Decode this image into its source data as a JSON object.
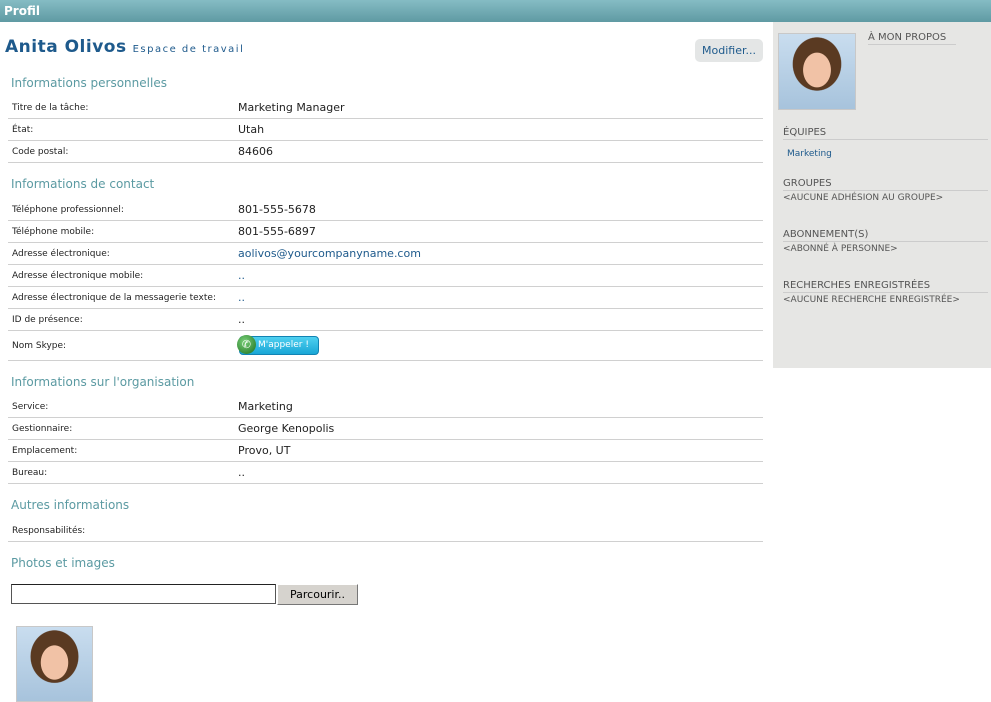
{
  "header": {
    "title": "Profil"
  },
  "profile": {
    "name": "Anita Olivos",
    "workspace": "Espace de travail",
    "modify_label": "Modifier..."
  },
  "sections": {
    "personal": {
      "title": "Informations personnelles",
      "rows": [
        {
          "label": "Titre de la tâche:",
          "value": "Marketing Manager"
        },
        {
          "label": "État:",
          "value": "Utah"
        },
        {
          "label": "Code postal:",
          "value": "84606"
        }
      ]
    },
    "contact": {
      "title": "Informations de contact",
      "rows": [
        {
          "label": "Téléphone professionnel:",
          "value": "801-555-5678"
        },
        {
          "label": "Téléphone mobile:",
          "value": "801-555-6897"
        },
        {
          "label": "Adresse électronique:",
          "value": "aolivos@yourcompanyname.com"
        },
        {
          "label": "Adresse électronique mobile:",
          "value": ".."
        },
        {
          "label": "Adresse électronique de la messagerie texte:",
          "value": ".."
        },
        {
          "label": "ID de présence:",
          "value": ".."
        },
        {
          "label": "Nom Skype:",
          "value": "M'appeler !"
        }
      ]
    },
    "org": {
      "title": "Informations sur l'organisation",
      "rows": [
        {
          "label": "Service:",
          "value": "Marketing"
        },
        {
          "label": "Gestionnaire:",
          "value": "George Kenopolis"
        },
        {
          "label": "Emplacement:",
          "value": "Provo, UT"
        },
        {
          "label": "Bureau:",
          "value": ".."
        }
      ]
    },
    "other": {
      "title": "Autres informations",
      "rows": [
        {
          "label": "Responsabilités:",
          "value": ""
        }
      ]
    },
    "photos": {
      "title": "Photos et images",
      "browse_label": "Parcourir..",
      "file_value": ""
    }
  },
  "sidebar": {
    "about": "À MON PROPOS",
    "teams_title": "ÉQUIPES",
    "team": "Marketing",
    "groups_title": "GROUPES",
    "groups_value": "<AUCUNE ADHÉSION AU GROUPE>",
    "subs_title": "ABONNEMENT(S)",
    "subs_value": "<ABONNÉ À PERSONNE>",
    "searches_title": "RECHERCHES ENREGISTRÉES",
    "searches_value": "<AUCUNE RECHERCHE ENREGISTRÉE>"
  }
}
